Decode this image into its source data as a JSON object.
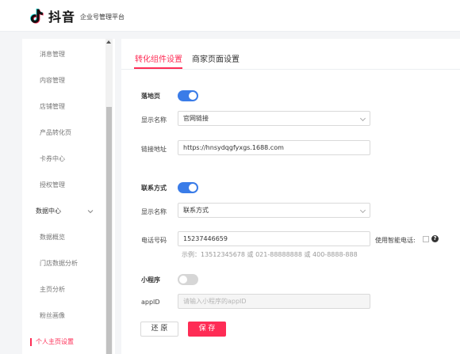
{
  "header": {
    "brand_name": "抖音",
    "brand_sub": "企业号管理平台"
  },
  "sidebar": {
    "items": [
      {
        "label": "消息管理"
      },
      {
        "label": "内容管理"
      },
      {
        "label": "店铺管理"
      },
      {
        "label": "产品转化页"
      },
      {
        "label": "卡券中心"
      },
      {
        "label": "授权管理"
      },
      {
        "label": "数据中心"
      },
      {
        "label": "数据概览"
      },
      {
        "label": "门店数据分析"
      },
      {
        "label": "主页分析"
      },
      {
        "label": "粉丝画像"
      },
      {
        "label": "个人主页设置"
      }
    ]
  },
  "tabs": [
    {
      "label": "转化组件设置"
    },
    {
      "label": "商家页面设置"
    }
  ],
  "form": {
    "landing": {
      "title": "落地页",
      "enabled": true,
      "display_name_label": "显示名称",
      "display_name_value": "官网链接",
      "url_label": "链接地址",
      "url_value": "https://hnsydqgfyxgs.1688.com"
    },
    "contact": {
      "title": "联系方式",
      "enabled": true,
      "display_name_label": "显示名称",
      "display_name_value": "联系方式",
      "phone_label": "电话号码",
      "phone_value": "15237446659",
      "smart_call_label": "使用智能电话:",
      "smart_call_checked": false,
      "phone_hint": "示例：13512345678 或 021-88888888 或 400-8888-888"
    },
    "miniprogram": {
      "title": "小程序",
      "enabled": false,
      "appid_label": "appID",
      "appid_placeholder": "请输入小程序的appID"
    }
  },
  "buttons": {
    "reset": "还 原",
    "save": "保 存"
  },
  "colors": {
    "accent": "#fe2c55",
    "toggle_on": "#3a7ce8"
  }
}
